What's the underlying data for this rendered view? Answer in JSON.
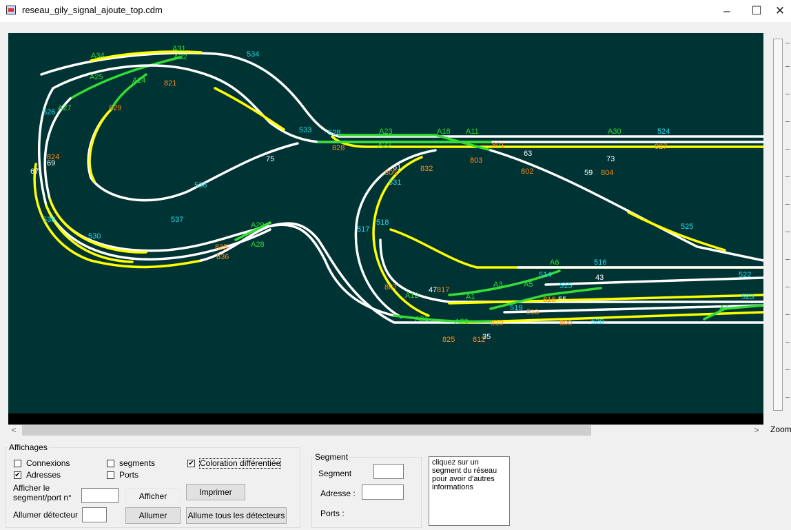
{
  "window": {
    "title": "reseau_gily_signal_ajoute_top.cdm",
    "minimize": "–",
    "maximize": "☐",
    "close": "✕"
  },
  "scroll": {
    "left": "<",
    "right": ">"
  },
  "zoom_label": "Zoom",
  "affichages": {
    "legend": "Affichages",
    "connexions": "Connexions",
    "segments": "segments",
    "coloration": "Coloration différentiée",
    "adresses": "Adresses",
    "ports": "Ports",
    "afficher_label_1": "Afficher le",
    "afficher_label_2": "segment/port n°",
    "afficher_btn": "Afficher",
    "imprimer_btn": "Imprimer",
    "allumer_label": "Allumer détecteur",
    "allumer_btn": "Allumer",
    "allume_tous_btn": "Allume tous les détecteurs",
    "checked": {
      "connexions": false,
      "segments": false,
      "coloration": true,
      "adresses": true,
      "ports": false
    }
  },
  "segment_panel": {
    "legend": "Segment",
    "segment_label": "Segment",
    "adresse_label": "Adresse :",
    "ports_label": "Ports :"
  },
  "info": {
    "text": "cliquez sur un segment du réseau pour avoir d'autres informations"
  },
  "colors": {
    "background": "#003333",
    "track": "#ffffff",
    "occupied": "#ffff00",
    "switch": "#33dd33",
    "address": "#ff8c1a",
    "detector": "#22ddee"
  },
  "track_labels": {
    "switches": [
      "A34",
      "A31",
      "A32",
      "A25",
      "A24",
      "A27",
      "A23",
      "A22",
      "A18",
      "A11",
      "A30",
      "A29",
      "A28",
      "A6",
      "A3",
      "A5",
      "A1",
      "A12",
      "A20",
      "A21",
      "A7"
    ],
    "addresses": [
      "821",
      "829",
      "828",
      "827",
      "824",
      "803",
      "802",
      "804",
      "832",
      "801",
      "805",
      "836",
      "835",
      "807",
      "825",
      "816",
      "813",
      "812",
      "810",
      "800",
      "817"
    ],
    "detectors": [
      "534",
      "533",
      "526",
      "530",
      "537",
      "536",
      "528",
      "538",
      "531",
      "517",
      "518",
      "516",
      "514",
      "515",
      "519",
      "520",
      "523",
      "522",
      "524",
      "525"
    ],
    "white": [
      "75",
      "69",
      "73",
      "63",
      "59",
      "61",
      "43",
      "55",
      "35",
      "67",
      "47"
    ]
  }
}
